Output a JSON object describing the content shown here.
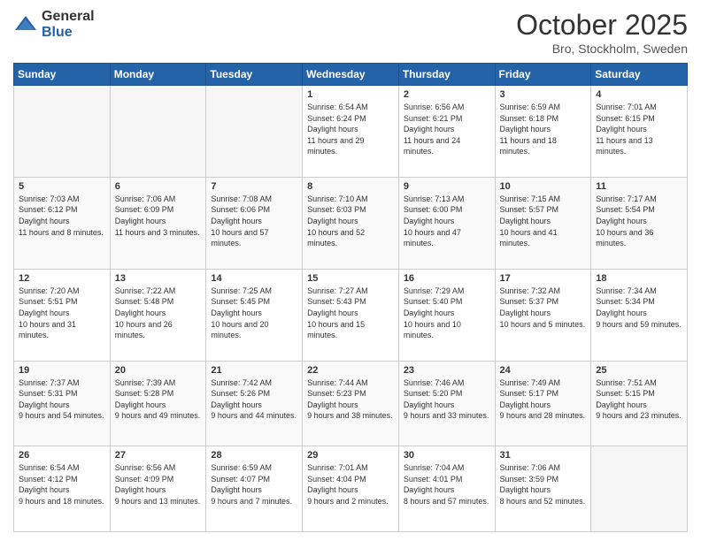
{
  "header": {
    "logo_general": "General",
    "logo_blue": "Blue",
    "month": "October 2025",
    "location": "Bro, Stockholm, Sweden"
  },
  "days_of_week": [
    "Sunday",
    "Monday",
    "Tuesday",
    "Wednesday",
    "Thursday",
    "Friday",
    "Saturday"
  ],
  "weeks": [
    [
      {
        "day": "",
        "empty": true
      },
      {
        "day": "",
        "empty": true
      },
      {
        "day": "",
        "empty": true
      },
      {
        "day": "1",
        "sunrise": "6:54 AM",
        "sunset": "6:24 PM",
        "daylight": "11 hours and 29 minutes."
      },
      {
        "day": "2",
        "sunrise": "6:56 AM",
        "sunset": "6:21 PM",
        "daylight": "11 hours and 24 minutes."
      },
      {
        "day": "3",
        "sunrise": "6:59 AM",
        "sunset": "6:18 PM",
        "daylight": "11 hours and 18 minutes."
      },
      {
        "day": "4",
        "sunrise": "7:01 AM",
        "sunset": "6:15 PM",
        "daylight": "11 hours and 13 minutes."
      }
    ],
    [
      {
        "day": "5",
        "sunrise": "7:03 AM",
        "sunset": "6:12 PM",
        "daylight": "11 hours and 8 minutes."
      },
      {
        "day": "6",
        "sunrise": "7:06 AM",
        "sunset": "6:09 PM",
        "daylight": "11 hours and 3 minutes."
      },
      {
        "day": "7",
        "sunrise": "7:08 AM",
        "sunset": "6:06 PM",
        "daylight": "10 hours and 57 minutes."
      },
      {
        "day": "8",
        "sunrise": "7:10 AM",
        "sunset": "6:03 PM",
        "daylight": "10 hours and 52 minutes."
      },
      {
        "day": "9",
        "sunrise": "7:13 AM",
        "sunset": "6:00 PM",
        "daylight": "10 hours and 47 minutes."
      },
      {
        "day": "10",
        "sunrise": "7:15 AM",
        "sunset": "5:57 PM",
        "daylight": "10 hours and 41 minutes."
      },
      {
        "day": "11",
        "sunrise": "7:17 AM",
        "sunset": "5:54 PM",
        "daylight": "10 hours and 36 minutes."
      }
    ],
    [
      {
        "day": "12",
        "sunrise": "7:20 AM",
        "sunset": "5:51 PM",
        "daylight": "10 hours and 31 minutes."
      },
      {
        "day": "13",
        "sunrise": "7:22 AM",
        "sunset": "5:48 PM",
        "daylight": "10 hours and 26 minutes."
      },
      {
        "day": "14",
        "sunrise": "7:25 AM",
        "sunset": "5:45 PM",
        "daylight": "10 hours and 20 minutes."
      },
      {
        "day": "15",
        "sunrise": "7:27 AM",
        "sunset": "5:43 PM",
        "daylight": "10 hours and 15 minutes."
      },
      {
        "day": "16",
        "sunrise": "7:29 AM",
        "sunset": "5:40 PM",
        "daylight": "10 hours and 10 minutes."
      },
      {
        "day": "17",
        "sunrise": "7:32 AM",
        "sunset": "5:37 PM",
        "daylight": "10 hours and 5 minutes."
      },
      {
        "day": "18",
        "sunrise": "7:34 AM",
        "sunset": "5:34 PM",
        "daylight": "9 hours and 59 minutes."
      }
    ],
    [
      {
        "day": "19",
        "sunrise": "7:37 AM",
        "sunset": "5:31 PM",
        "daylight": "9 hours and 54 minutes."
      },
      {
        "day": "20",
        "sunrise": "7:39 AM",
        "sunset": "5:28 PM",
        "daylight": "9 hours and 49 minutes."
      },
      {
        "day": "21",
        "sunrise": "7:42 AM",
        "sunset": "5:26 PM",
        "daylight": "9 hours and 44 minutes."
      },
      {
        "day": "22",
        "sunrise": "7:44 AM",
        "sunset": "5:23 PM",
        "daylight": "9 hours and 38 minutes."
      },
      {
        "day": "23",
        "sunrise": "7:46 AM",
        "sunset": "5:20 PM",
        "daylight": "9 hours and 33 minutes."
      },
      {
        "day": "24",
        "sunrise": "7:49 AM",
        "sunset": "5:17 PM",
        "daylight": "9 hours and 28 minutes."
      },
      {
        "day": "25",
        "sunrise": "7:51 AM",
        "sunset": "5:15 PM",
        "daylight": "9 hours and 23 minutes."
      }
    ],
    [
      {
        "day": "26",
        "sunrise": "6:54 AM",
        "sunset": "4:12 PM",
        "daylight": "9 hours and 18 minutes."
      },
      {
        "day": "27",
        "sunrise": "6:56 AM",
        "sunset": "4:09 PM",
        "daylight": "9 hours and 13 minutes."
      },
      {
        "day": "28",
        "sunrise": "6:59 AM",
        "sunset": "4:07 PM",
        "daylight": "9 hours and 7 minutes."
      },
      {
        "day": "29",
        "sunrise": "7:01 AM",
        "sunset": "4:04 PM",
        "daylight": "9 hours and 2 minutes."
      },
      {
        "day": "30",
        "sunrise": "7:04 AM",
        "sunset": "4:01 PM",
        "daylight": "8 hours and 57 minutes."
      },
      {
        "day": "31",
        "sunrise": "7:06 AM",
        "sunset": "3:59 PM",
        "daylight": "8 hours and 52 minutes."
      },
      {
        "day": "",
        "empty": true
      }
    ]
  ],
  "labels": {
    "sunrise": "Sunrise:",
    "sunset": "Sunset:",
    "daylight": "Daylight hours"
  }
}
